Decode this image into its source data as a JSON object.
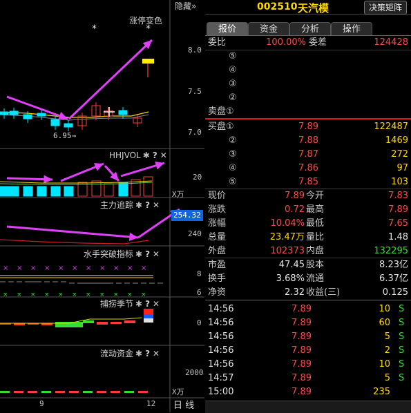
{
  "header": {
    "hide_label": "隐藏",
    "hide_chevrons": "»",
    "stock_code": "002510",
    "stock_name": "天汽模",
    "decision_button": "决策矩阵"
  },
  "tabs": [
    "报价",
    "资金",
    "分析",
    "操作"
  ],
  "order_book": {
    "ratio_label": "委比",
    "ratio_value": "100.00%",
    "diff_label": "委差",
    "diff_value": "124428",
    "sell_label": "卖盘①",
    "sell_levels": [
      "⑤",
      "④",
      "③",
      "②"
    ],
    "buy_label": "买盘①",
    "buy_first_price": "7.89",
    "buy_first_vol": "122487",
    "buy_levels": [
      {
        "level": "②",
        "price": "7.88",
        "vol": "1469"
      },
      {
        "level": "③",
        "price": "7.87",
        "vol": "272"
      },
      {
        "level": "④",
        "price": "7.86",
        "vol": "97"
      },
      {
        "level": "⑤",
        "price": "7.85",
        "vol": "103"
      }
    ]
  },
  "quote": {
    "rows": [
      {
        "l1": "现价",
        "v1": "7.89",
        "c1": "red",
        "l2": "今开",
        "v2": "7.83",
        "c2": "red"
      },
      {
        "l1": "涨跌",
        "v1": "0.72",
        "c1": "red",
        "l2": "最高",
        "v2": "7.89",
        "c2": "red"
      },
      {
        "l1": "涨幅",
        "v1": "10.04%",
        "c1": "red",
        "l2": "最低",
        "v2": "7.65",
        "c2": "red"
      },
      {
        "l1": "总量",
        "v1": "23.47万",
        "c1": "yellow",
        "l2": "量比",
        "v2": "1.48",
        "c2": "white"
      },
      {
        "l1": "外盘",
        "v1": "102373",
        "c1": "red",
        "l2": "内盘",
        "v2": "132295",
        "c2": "green"
      }
    ],
    "rows2": [
      {
        "l1": "市盈",
        "v1": "47.45",
        "l2": "股本",
        "v2": "8.23亿"
      },
      {
        "l1": "换手",
        "v1": "3.68%",
        "l2": "流通",
        "v2": "6.37亿"
      },
      {
        "l1": "净资",
        "v1": "2.32",
        "l2": "收益(三)",
        "v2": "0.125"
      }
    ]
  },
  "ticks": [
    {
      "time": "14:56",
      "price": "7.89",
      "vol": "10",
      "side": "S"
    },
    {
      "time": "14:56",
      "price": "7.89",
      "vol": "60",
      "side": "S"
    },
    {
      "time": "14:56",
      "price": "7.89",
      "vol": "5",
      "side": "S"
    },
    {
      "time": "14:56",
      "price": "7.89",
      "vol": "2",
      "side": "S"
    },
    {
      "time": "14:56",
      "price": "7.89",
      "vol": "10",
      "side": "S"
    },
    {
      "time": "14:57",
      "price": "7.89",
      "vol": "5",
      "side": "S"
    },
    {
      "time": "15:00",
      "price": "7.89",
      "vol": "235",
      "side": ""
    }
  ],
  "chart": {
    "main_title": "涨停变色",
    "price_axis": [
      "8.0",
      "7.5",
      "7.0"
    ],
    "low_annotation": "6.95→",
    "star": "*",
    "panels": [
      {
        "title": "HHJVOL",
        "axis": [
          "20"
        ],
        "unit": "X万"
      },
      {
        "title": "主力追踪",
        "axis": [
          "254.32",
          "240"
        ]
      },
      {
        "title": "水手突破指标",
        "axis": [
          "8",
          "6"
        ]
      },
      {
        "title": "捕捞季节",
        "axis": [
          "0"
        ]
      },
      {
        "title": "流动资金",
        "axis": [
          "2000"
        ],
        "unit": "X万"
      }
    ],
    "gear": "✱",
    "help": "?",
    "close": "✕",
    "x_labels": [
      "9",
      "12"
    ],
    "period_label": "日 线",
    "colors": {
      "up": "#ff3b3b",
      "down": "#00e5ff",
      "arrow": "#e040fb",
      "ma": "#ffd700"
    }
  }
}
